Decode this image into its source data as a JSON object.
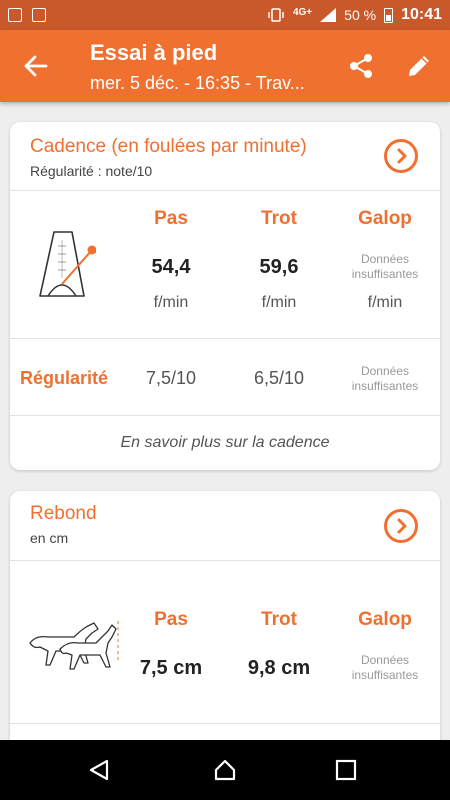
{
  "status_bar": {
    "network": "4G+",
    "battery": "50 %",
    "time": "10:41"
  },
  "app_bar": {
    "title": "Essai à pied",
    "subtitle": "mer. 5 déc. - 16:35 - Trav..."
  },
  "cadence": {
    "title": "Cadence (en foulées par minute)",
    "subtitle": "Régularité : note/10",
    "columns": [
      "Pas",
      "Trot",
      "Galop"
    ],
    "values": [
      "54,4",
      "59,6",
      ""
    ],
    "units": [
      "f/min",
      "f/min",
      "f/min"
    ],
    "insufficient": "Données insuffisantes",
    "regularity_label": "Régularité",
    "regularity_values": [
      "7,5/10",
      "6,5/10"
    ],
    "learn_more": "En savoir plus sur la cadence"
  },
  "rebond": {
    "title": "Rebond",
    "subtitle": "en cm",
    "columns": [
      "Pas",
      "Trot",
      "Galop"
    ],
    "values": [
      "7,5 cm",
      "9,8 cm"
    ],
    "insufficient": "Données insuffisantes"
  },
  "colors": {
    "accent": "#f07030",
    "status_bar": "#c9582a",
    "background": "#eeeeee"
  }
}
